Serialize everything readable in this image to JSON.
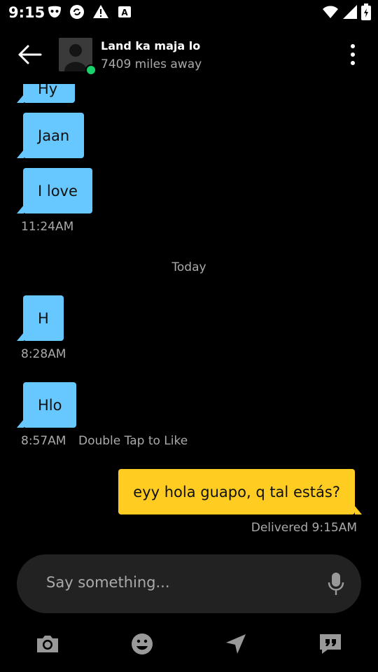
{
  "status": {
    "time": "9:15"
  },
  "header": {
    "name": "Land ka maja lo",
    "distance": "7409 miles away"
  },
  "messages": {
    "m0": "Hy",
    "m1": "Jaan",
    "m2": "I love",
    "t1": "11:24AM",
    "day": "Today",
    "m3": "H",
    "t2": "8:28AM",
    "m4": "Hlo",
    "t3": "8:57AM",
    "hint": "Double Tap to Like",
    "out": "eyy hola guapo, q tal estás?",
    "delivered": "Delivered 9:15AM"
  },
  "input": {
    "placeholder": "Say something..."
  },
  "colors": {
    "incoming": "#66c8ff",
    "outgoing": "#ffcc22",
    "online": "#18d26a"
  },
  "icons": [
    "back-icon",
    "menu-icon",
    "camera-icon",
    "emoji-icon",
    "location-icon",
    "quote-icon",
    "mic-icon"
  ]
}
